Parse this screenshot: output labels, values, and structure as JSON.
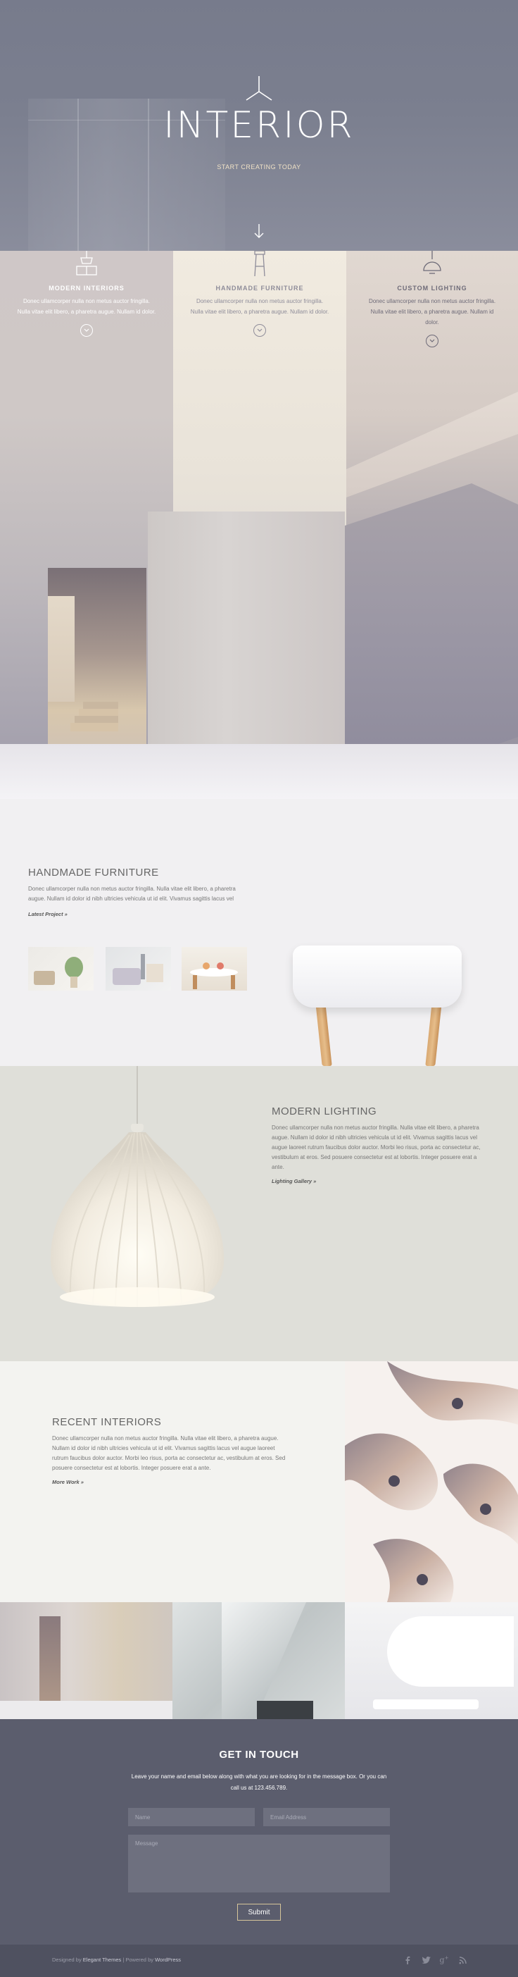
{
  "hero": {
    "title": "INTERIOR",
    "tagline": "START CREATING TODAY"
  },
  "services": [
    {
      "title": "MODERN INTERIORS",
      "text": "Donec ullamcorper nulla non metus auctor fringilla. Nulla vitae elit libero, a pharetra augue. Nullam id dolor.",
      "icon": "table-lamp-icon",
      "color": "#ffffff"
    },
    {
      "title": "HANDMADE FURNITURE",
      "text": "Donec ullamcorper nulla non metus auctor fringilla. Nulla vitae elit libero, a pharetra augue. Nullam id dolor.",
      "icon": "stool-icon",
      "color": "#8f8d9a"
    },
    {
      "title": "CUSTOM LIGHTING",
      "text": "Donec ullamcorper nulla non metus auctor fringilla. Nulla vitae elit libero, a pharetra augue. Nullam id dolor.",
      "icon": "pendant-lamp-icon",
      "color": "#6e6b78"
    }
  ],
  "furniture": {
    "title": "HANDMADE FURNITURE",
    "text": "Donec ullamcorper nulla non metus auctor fringilla. Nulla vitae elit libero, a pharetra augue. Nullam id dolor id nibh ultricies vehicula ut id elit. Vivamus sagittis lacus vel",
    "link": "Latest Project »"
  },
  "lighting": {
    "title": "MODERN LIGHTING",
    "text": "Donec ullamcorper nulla non metus auctor fringilla. Nulla vitae elit libero, a pharetra augue. Nullam id dolor id nibh ultricies vehicula ut id elit. Vivamus sagittis lacus vel augue laoreet rutrum faucibus dolor auctor. Morbi leo risus, porta ac consectetur ac, vestibulum at eros. Sed posuere consectetur est at lobortis. Integer posuere erat a ante.",
    "link": "Lighting Gallery »"
  },
  "recent": {
    "title": "RECENT INTERIORS",
    "text": "Donec ullamcorper nulla non metus auctor fringilla. Nulla vitae elit libero, a pharetra augue. Nullam id dolor id nibh ultricies vehicula ut id elit. Vivamus sagittis lacus vel augue laoreet rutrum faucibus dolor auctor. Morbi leo risus, porta ac consectetur ac, vestibulum at eros. Sed posuere consectetur est at lobortis. Integer posuere erat a ante.",
    "link": "More Work »"
  },
  "contact": {
    "title": "GET IN TOUCH",
    "text": "Leave your name and email below along with what you are looking for in the message box. Or you can call us at 123.456.789.",
    "name_placeholder": "Name",
    "email_placeholder": "Email Address",
    "message_placeholder": "Message",
    "submit_label": "Submit"
  },
  "footer": {
    "prefix": "Designed by ",
    "brand": "Elegant Themes",
    "separator": " | Powered by ",
    "platform": "WordPress",
    "social": [
      "facebook-icon",
      "twitter-icon",
      "google-plus-icon",
      "rss-icon"
    ]
  }
}
